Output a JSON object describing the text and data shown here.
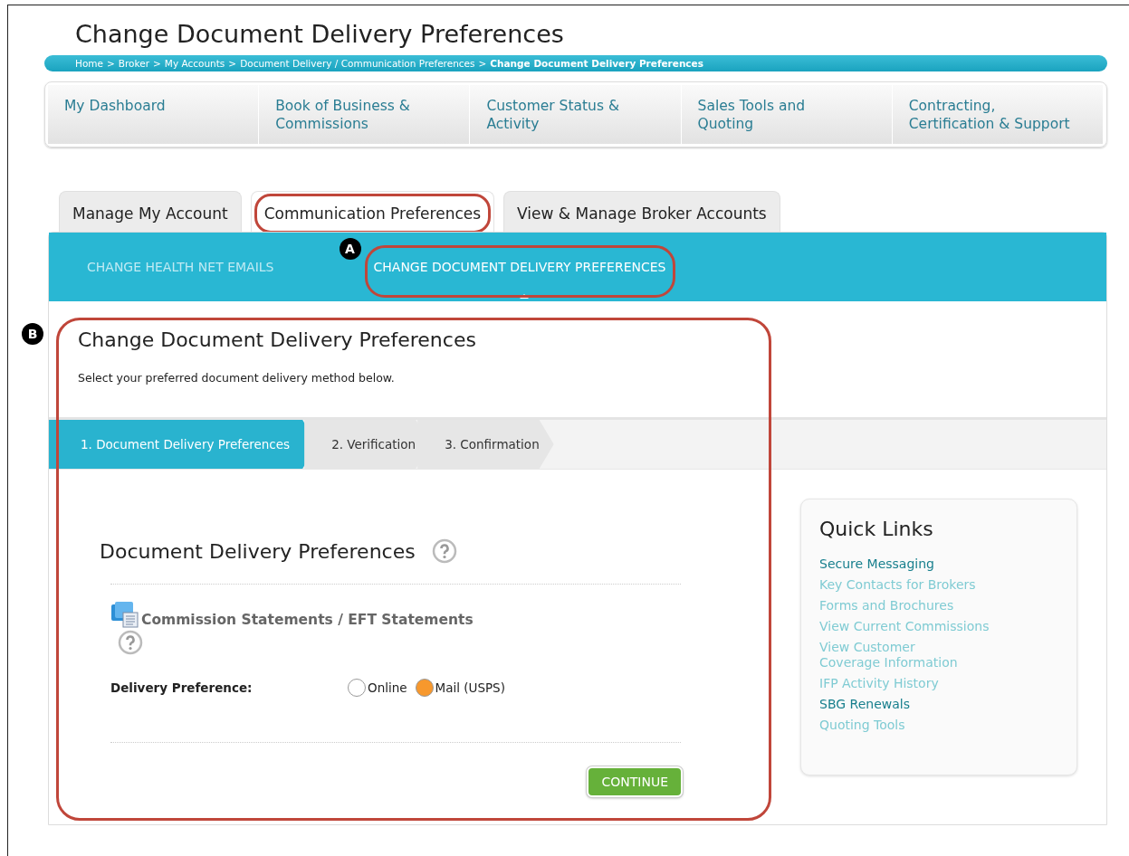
{
  "page_title": "Change Document Delivery Preferences",
  "breadcrumb": [
    {
      "label": "Home",
      "current": false
    },
    {
      "label": "Broker",
      "current": false
    },
    {
      "label": "My Accounts",
      "current": false
    },
    {
      "label": "Document Delivery / Communication Preferences",
      "current": false
    },
    {
      "label": "Change Document Delivery Preferences",
      "current": true
    }
  ],
  "breadcrumb_separator": ">",
  "main_nav": [
    "My Dashboard",
    "Book of Business & Commissions",
    "Customer Status & Activity",
    "Sales Tools and Quoting",
    "Contracting, Certification & Support"
  ],
  "tabs": [
    {
      "label": "Manage My Account",
      "selected": false
    },
    {
      "label": "Communication Preferences",
      "selected": true
    },
    {
      "label": "View & Manage Broker Accounts",
      "selected": false
    }
  ],
  "sub_tabs": [
    {
      "label": "CHANGE HEALTH NET EMAILS",
      "selected": false
    },
    {
      "label": "CHANGE DOCUMENT DELIVERY PREFERENCES",
      "selected": true
    }
  ],
  "section": {
    "title": "Change Document Delivery Preferences",
    "description": "Select your preferred document delivery method below."
  },
  "steps": [
    {
      "label": "1. Document Delivery Preferences",
      "selected": true
    },
    {
      "label": "2. Verification",
      "selected": false
    },
    {
      "label": "3. Confirmation",
      "selected": false
    }
  ],
  "form": {
    "title": "Document Delivery Preferences",
    "group_title": "Commission Statements / EFT Statements",
    "field_label": "Delivery Preference:",
    "options": [
      {
        "label": "Online",
        "selected": false
      },
      {
        "label": "Mail (USPS)",
        "selected": true
      }
    ],
    "button": "CONTINUE"
  },
  "quick_links": {
    "title": "Quick Links",
    "links": [
      {
        "label": "Secure Messaging",
        "visited": true
      },
      {
        "label": "Key Contacts for Brokers",
        "visited": false
      },
      {
        "label": "Forms and Brochures",
        "visited": false
      },
      {
        "label": "View Current Commissions",
        "visited": false
      },
      {
        "label": "View Customer\nCoverage Information",
        "visited": false
      },
      {
        "label": "IFP Activity History",
        "visited": false
      },
      {
        "label": "SBG Renewals",
        "visited": true
      },
      {
        "label": "Quoting Tools",
        "visited": false
      }
    ]
  },
  "annotations": [
    {
      "label": "A"
    },
    {
      "label": "B"
    }
  ]
}
